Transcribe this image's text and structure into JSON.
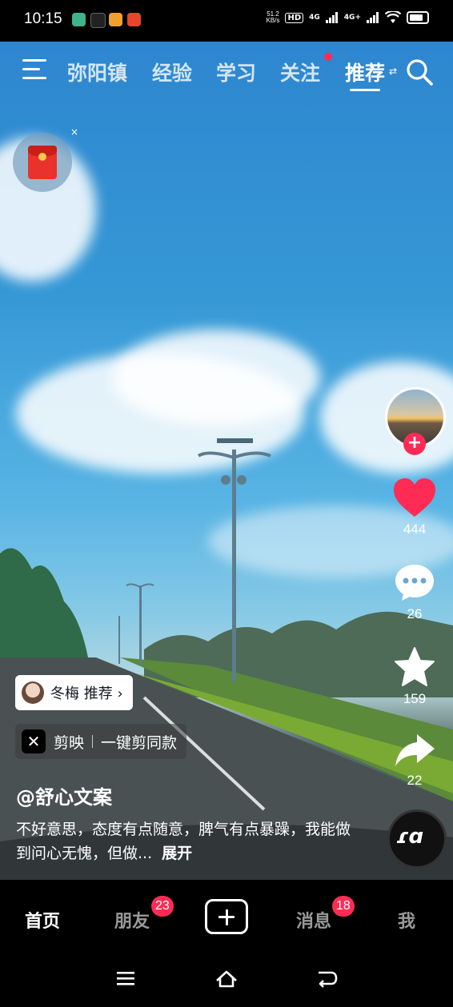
{
  "status_bar": {
    "time": "10:15",
    "net_speed_value": "51.2",
    "net_speed_unit": "KB/s",
    "hd_label": "HD",
    "signal_1": "4G",
    "signal_2": "4G+"
  },
  "top_nav": {
    "tabs": [
      {
        "label": "弥阳镇",
        "active": false
      },
      {
        "label": "经验",
        "active": false
      },
      {
        "label": "学习",
        "active": false
      },
      {
        "label": "关注",
        "active": false,
        "has_dot": true
      },
      {
        "label": "推荐",
        "active": true
      }
    ]
  },
  "red_packet": {
    "close_glyph": "×"
  },
  "right_rail": {
    "like_count": "444",
    "comment_count": "26",
    "favorite_count": "159",
    "share_count": "22",
    "music_disc_text": "ɾɑ"
  },
  "video_info": {
    "recommend_chip": "冬梅 推荐 ›",
    "capcut_app": "剪映",
    "capcut_action": "一键剪同款",
    "author": "@舒心文案",
    "caption": "不好意思，态度有点随意，脾气有点暴躁，我能做到问心无愧，但做...",
    "expand_label": "展开"
  },
  "bottom_nav": {
    "home": "首页",
    "friends": "朋友",
    "friends_badge": "23",
    "messages": "消息",
    "messages_badge": "18",
    "me": "我"
  },
  "colors": {
    "accent": "#fe2c55",
    "bar_bg": "#000000",
    "sky": "#3598d6"
  }
}
